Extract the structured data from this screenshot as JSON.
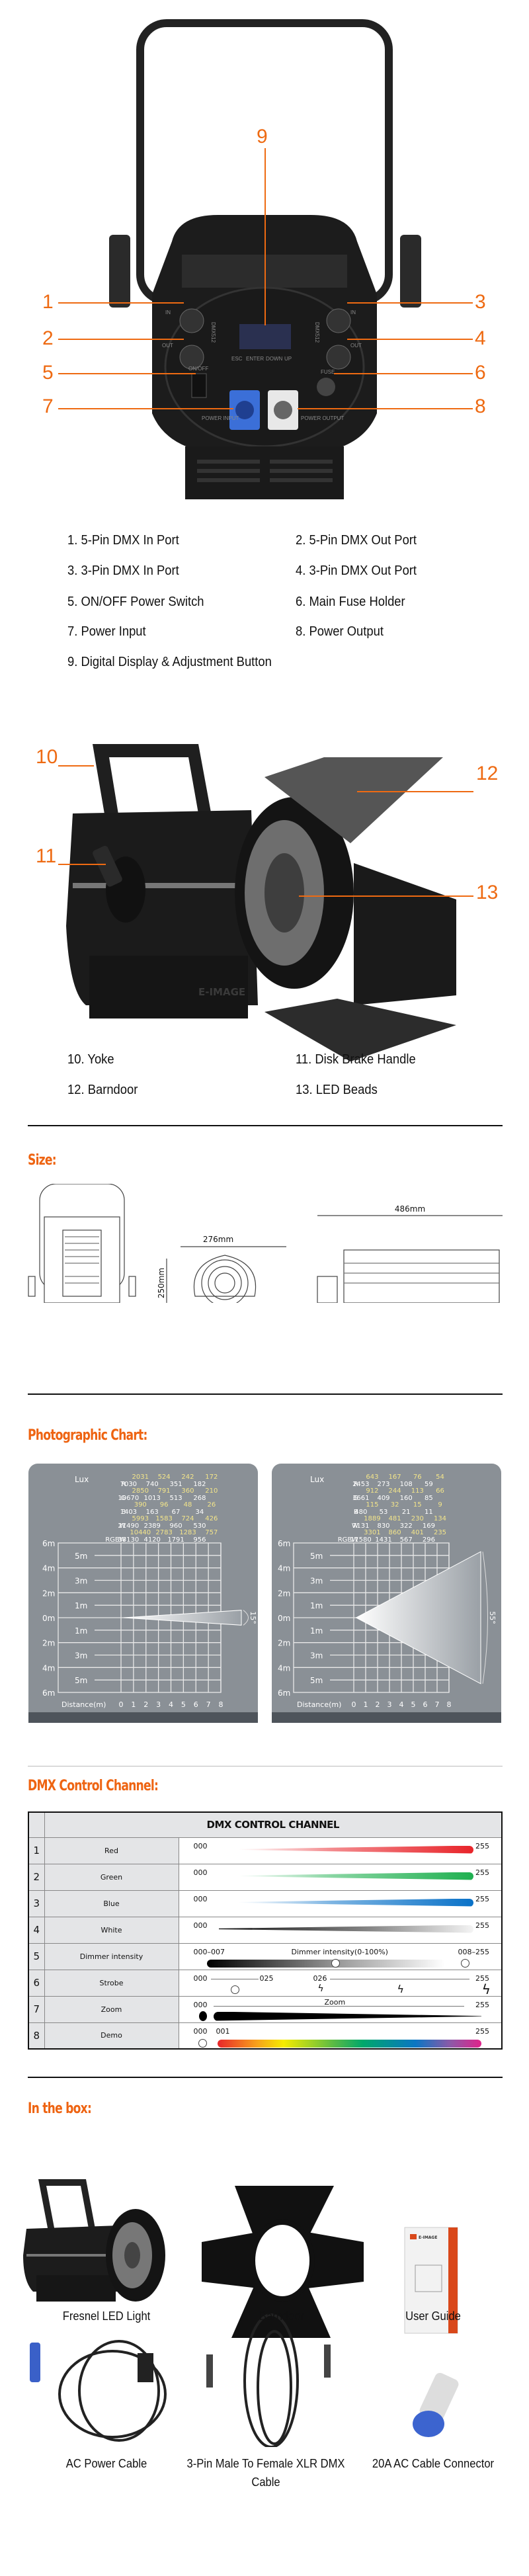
{
  "rear_view": {
    "callouts": [
      "1",
      "2",
      "3",
      "4",
      "5",
      "6",
      "7",
      "8",
      "9"
    ],
    "panel_labels": {
      "in": "IN",
      "out": "OUT",
      "dmx": "DMX512",
      "onoff": "ON/OFF",
      "on": "ON",
      "off": "OFF",
      "fuse": "FUSE",
      "power_input": "POWER INPUT",
      "power_output": "POWER OUTPUT",
      "buttons": [
        "ESC",
        "ENTER",
        "DOWN",
        "UP"
      ]
    },
    "features": [
      "1. 5-Pin DMX In Port",
      "2. 5-Pin DMX Out Port",
      "3. 3-Pin DMX In Port",
      "4. 3-Pin DMX Out Port",
      "5. ON/OFF Power Switch",
      "6. Main Fuse Holder",
      "7. Power Input",
      "8. Power Output",
      "9. Digital Display & Adjustment Button"
    ]
  },
  "side_view": {
    "callouts": [
      "10",
      "11",
      "12",
      "13"
    ],
    "brand": "E-IMAGE",
    "features": [
      "10. Yoke",
      "11. Disk Brake Handle",
      "12. Barndoor",
      "13. LED Beads"
    ]
  },
  "size": {
    "title": "Size:",
    "width": "276mm",
    "height": "250mm",
    "length": "486mm"
  },
  "photographic": {
    "title": "Photographic Chart:",
    "charts": [
      {
        "angle": "15°",
        "lux_label": "Lux",
        "distance_label": "Distance(m)",
        "distances": [
          "0",
          "1",
          "2",
          "3",
          "4",
          "5",
          "6",
          "7",
          "8"
        ],
        "heights": [
          "6m",
          "5m",
          "4m",
          "3m",
          "2m",
          "1m",
          "0m",
          "1m",
          "2m",
          "3m",
          "4m",
          "5m",
          "6m"
        ],
        "rows": [
          {
            "label": "R",
            "values": [
              7030,
              2031,
              740,
              524,
              351,
              242,
              182,
              172
            ]
          },
          {
            "label": "G",
            "values": [
              10670,
              2850,
              1013,
              791,
              513,
              360,
              268,
              210
            ]
          },
          {
            "label": "B",
            "values": [
              1403,
              390,
              163,
              96,
              67,
              48,
              34,
              26
            ]
          },
          {
            "label": "W",
            "values": [
              21490,
              5993,
              2389,
              1583,
              960,
              724,
              530,
              426
            ]
          },
          {
            "label": "RGBW",
            "values": [
              38130,
              10440,
              4120,
              2783,
              1791,
              1283,
              956,
              757
            ]
          }
        ]
      },
      {
        "angle": "55°",
        "lux_label": "Lux",
        "distance_label": "Distance(m)",
        "distances": [
          "0",
          "1",
          "2",
          "3",
          "4",
          "5",
          "6",
          "7",
          "8"
        ],
        "heights": [
          "6m",
          "5m",
          "4m",
          "3m",
          "2m",
          "1m",
          "0m",
          "1m",
          "2m",
          "3m",
          "4m",
          "5m",
          "6m"
        ],
        "rows": [
          {
            "label": "R",
            "values": [
              2453,
              643,
              273,
              167,
              108,
              76,
              59,
              54
            ]
          },
          {
            "label": "G",
            "values": [
              3661,
              912,
              409,
              244,
              160,
              113,
              85,
              66
            ]
          },
          {
            "label": "B",
            "values": [
              480,
              115,
              53,
              32,
              21,
              15,
              11,
              9
            ]
          },
          {
            "label": "W",
            "values": [
              7131,
              1889,
              830,
              481,
              322,
              230,
              169,
              134
            ]
          },
          {
            "label": "RGBW",
            "values": [
              11580,
              3301,
              1431,
              860,
              567,
              401,
              296,
              235
            ]
          }
        ]
      }
    ],
    "colors": {
      "panel": "#8a9096",
      "value_white": "#ffffff",
      "value_yellow": "#f3e58a"
    }
  },
  "dmx": {
    "title": "DMX Control Channel:",
    "header": "DMX CONTROL CHANNEL",
    "channels": [
      {
        "num": "1",
        "name": "Red",
        "min": "000",
        "max": "255",
        "color": "#e8242a"
      },
      {
        "num": "2",
        "name": "Green",
        "min": "000",
        "max": "255",
        "color": "#1fb050"
      },
      {
        "num": "3",
        "name": "Blue",
        "min": "000",
        "max": "255",
        "color": "#0a72c8"
      },
      {
        "num": "4",
        "name": "White",
        "min": "000",
        "max": "255"
      },
      {
        "num": "5",
        "name": "Dimmer intensity",
        "min": "000–007",
        "mid": "Dimmer intensity(0-100%)",
        "max": "008–255"
      },
      {
        "num": "6",
        "name": "Strobe",
        "min": "000",
        "a": "025",
        "b": "026",
        "max": "255"
      },
      {
        "num": "7",
        "name": "Zoom",
        "min": "000",
        "mid": "Zoom",
        "max": "255"
      },
      {
        "num": "8",
        "name": "Demo",
        "min": "000",
        "a": "001",
        "max": "255"
      }
    ]
  },
  "in_box": {
    "title": "In the box:",
    "items": [
      "Fresnel LED Light",
      "Barndoor",
      "User Guide",
      "AC Power Cable",
      "3-Pin Male To Female XLR DMX Cable",
      "20A AC Cable Connector"
    ],
    "manual_brand": "E-IMAGE"
  }
}
